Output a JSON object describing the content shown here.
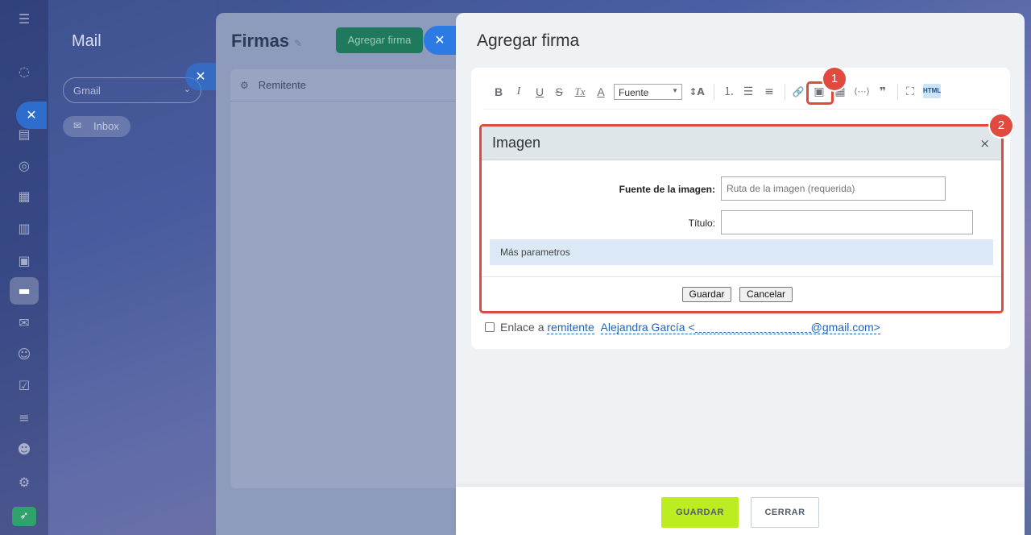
{
  "rail": {
    "menu_icon": "☰",
    "icons": [
      "◌",
      "▭",
      "▤",
      "◎",
      "▦",
      "▥",
      "▣",
      "▬",
      "✉",
      "☺",
      "☑",
      "≡",
      "☻",
      "⚙",
      "➶"
    ]
  },
  "mail": {
    "title": "Mail",
    "account_select": "Gmail",
    "chevron": "⌄",
    "inbox_label": "Inbox",
    "inbox_icon": "✉",
    "close_glyph": "✕"
  },
  "firmas": {
    "title": "Firmas",
    "pen_icon": "✎",
    "add_button": "Agregar firma",
    "close_glyph": "✕",
    "column_header": "Remitente",
    "gear_icon": "⚙"
  },
  "slider": {
    "title": "Agregar firma"
  },
  "toolbar": {
    "bold": "B",
    "italic": "I",
    "underline": "U",
    "strike": "S",
    "clear_format": "Tx",
    "font_color": "A",
    "font_select": "Fuente",
    "font_size": "↕A",
    "ordered_list": "⒈",
    "bullet_list": "☰",
    "align": "≡",
    "link": "🔗",
    "image": "▣",
    "table": "▦",
    "code": "⟨⋯⟩",
    "quote": "❞",
    "fullscreen": "⛶",
    "html": "HTML"
  },
  "badges": {
    "one": "1",
    "two": "2"
  },
  "dialog": {
    "title": "Imagen",
    "close_glyph": "×",
    "source_label": "Fuente de la imagen:",
    "source_placeholder": "Ruta de la imagen (requerida)",
    "title_label": "Título:",
    "title_value": "",
    "more_params": "Más parametros",
    "save": "Guardar",
    "cancel": "Cancelar"
  },
  "link_option": {
    "prefix": "Enlace a",
    "link_text": "remitente",
    "sender_name": "Alejandra García <",
    "sender_domain": "@gmail.com>"
  },
  "footer": {
    "save": "GUARDAR",
    "close": "CERRAR"
  },
  "colors": {
    "accent_green": "#bbed21",
    "highlight_red": "#e04a3f",
    "link_blue": "#1f63b8"
  }
}
